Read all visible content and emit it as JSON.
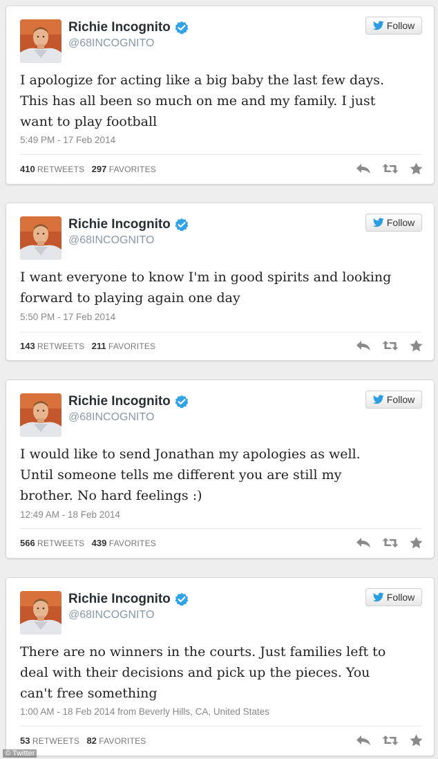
{
  "tweets": [
    {
      "name": "Richie Incognito",
      "handle": "@68INCOGNITO",
      "follow_label": "Follow",
      "text": "I apologize for acting like a big baby the last few days.\nThis has all been so much on me and my family.  I just\nwant to play football",
      "time": "5:49 PM - 17 Feb 2014",
      "retweets": "410",
      "retweets_label": "RETWEETS",
      "favorites": "297",
      "favorites_label": "FAVORITES"
    },
    {
      "name": "Richie Incognito",
      "handle": "@68INCOGNITO",
      "follow_label": "Follow",
      "text": "I want everyone to know I'm in good spirits and looking\nforward to playing again one day",
      "time": "5:50 PM - 17 Feb 2014",
      "retweets": "143",
      "retweets_label": "RETWEETS",
      "favorites": "211",
      "favorites_label": "FAVORITES"
    },
    {
      "name": "Richie Incognito",
      "handle": "@68INCOGNITO",
      "follow_label": "Follow",
      "text": "I would like to send Jonathan my apologies as well.\nUntil someone tells me different you are still my\nbrother.  No hard feelings :)",
      "time": "12:49 AM - 18 Feb 2014",
      "retweets": "566",
      "retweets_label": "RETWEETS",
      "favorites": "439",
      "favorites_label": "FAVORITES"
    },
    {
      "name": "Richie Incognito",
      "handle": "@68INCOGNITO",
      "follow_label": "Follow",
      "text": "There are no winners in the courts.  Just families left to\ndeal with their decisions and pick up the pieces.  You\ncan't free something",
      "time": "1:00 AM - 18 Feb 2014 from Beverly Hills, CA, United States",
      "retweets": "53",
      "retweets_label": "RETWEETS",
      "favorites": "82",
      "favorites_label": "FAVORITES"
    }
  ],
  "icons": {
    "verified": "verified-badge-icon",
    "follow": "twitter-bird-icon",
    "reply": "reply-icon",
    "retweet": "retweet-icon",
    "favorite": "star-icon"
  },
  "colors": {
    "verified": "#2fa3e6",
    "twitter_blue": "#2b9de0",
    "action_icon": "#8a8a8a"
  },
  "watermark": "© Twitter"
}
